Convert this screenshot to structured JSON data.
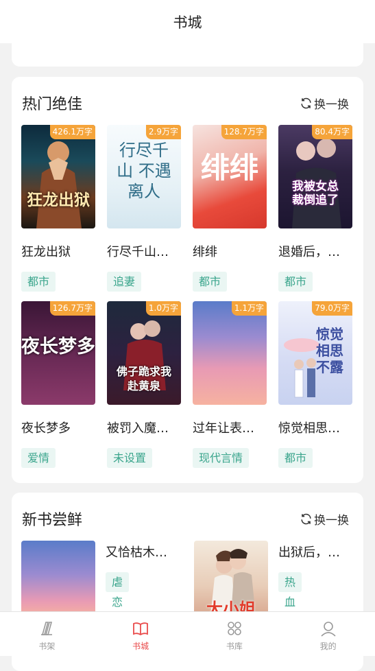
{
  "header": {
    "title": "书城"
  },
  "hot": {
    "title": "热门绝佳",
    "refresh_label": "换一换",
    "books": [
      {
        "title": "狂龙出狱",
        "words": "426.1万字",
        "tag": "都市",
        "cover_text": "狂龙出狱"
      },
      {
        "title": "行尽千山…",
        "words": "2.9万字",
        "tag": "追妻",
        "cover_text": "行尽千山 不遇离人"
      },
      {
        "title": "绯绯",
        "words": "128.7万字",
        "tag": "都市",
        "cover_text": "绯绯"
      },
      {
        "title": "退婚后，…",
        "words": "80.4万字",
        "tag": "都市",
        "cover_text": "我被女总裁倒追了"
      },
      {
        "title": "夜长梦多",
        "words": "126.7万字",
        "tag": "爱情",
        "cover_text": "夜长梦多"
      },
      {
        "title": "被罚入魔…",
        "words": "1.0万字",
        "tag": "未设置",
        "cover_text": "佛子跪求我赴黄泉"
      },
      {
        "title": "过年让表…",
        "words": "1.1万字",
        "tag": "现代言情",
        "cover_text": ""
      },
      {
        "title": "惊觉相思…",
        "words": "79.0万字",
        "tag": "都市",
        "cover_text": "惊觉相思不露"
      }
    ]
  },
  "new_books": {
    "title": "新书尝鲜",
    "refresh_label": "换一换",
    "books": [
      {
        "title": "又恰枯木…",
        "tag": "虐恋"
      },
      {
        "title": "出狱后，…",
        "tag": "热血",
        "cover_text": "大小姐"
      }
    ]
  },
  "tabs": [
    {
      "label": "书架",
      "icon": "bookshelf-icon"
    },
    {
      "label": "书城",
      "icon": "bookstore-icon",
      "active": true
    },
    {
      "label": "书库",
      "icon": "library-icon"
    },
    {
      "label": "我的",
      "icon": "profile-icon"
    }
  ],
  "colors": {
    "accent": "#e94b4b",
    "badge": "#f5a43a",
    "tag_text": "#3aa58c",
    "tag_bg": "#eaf6f3"
  }
}
